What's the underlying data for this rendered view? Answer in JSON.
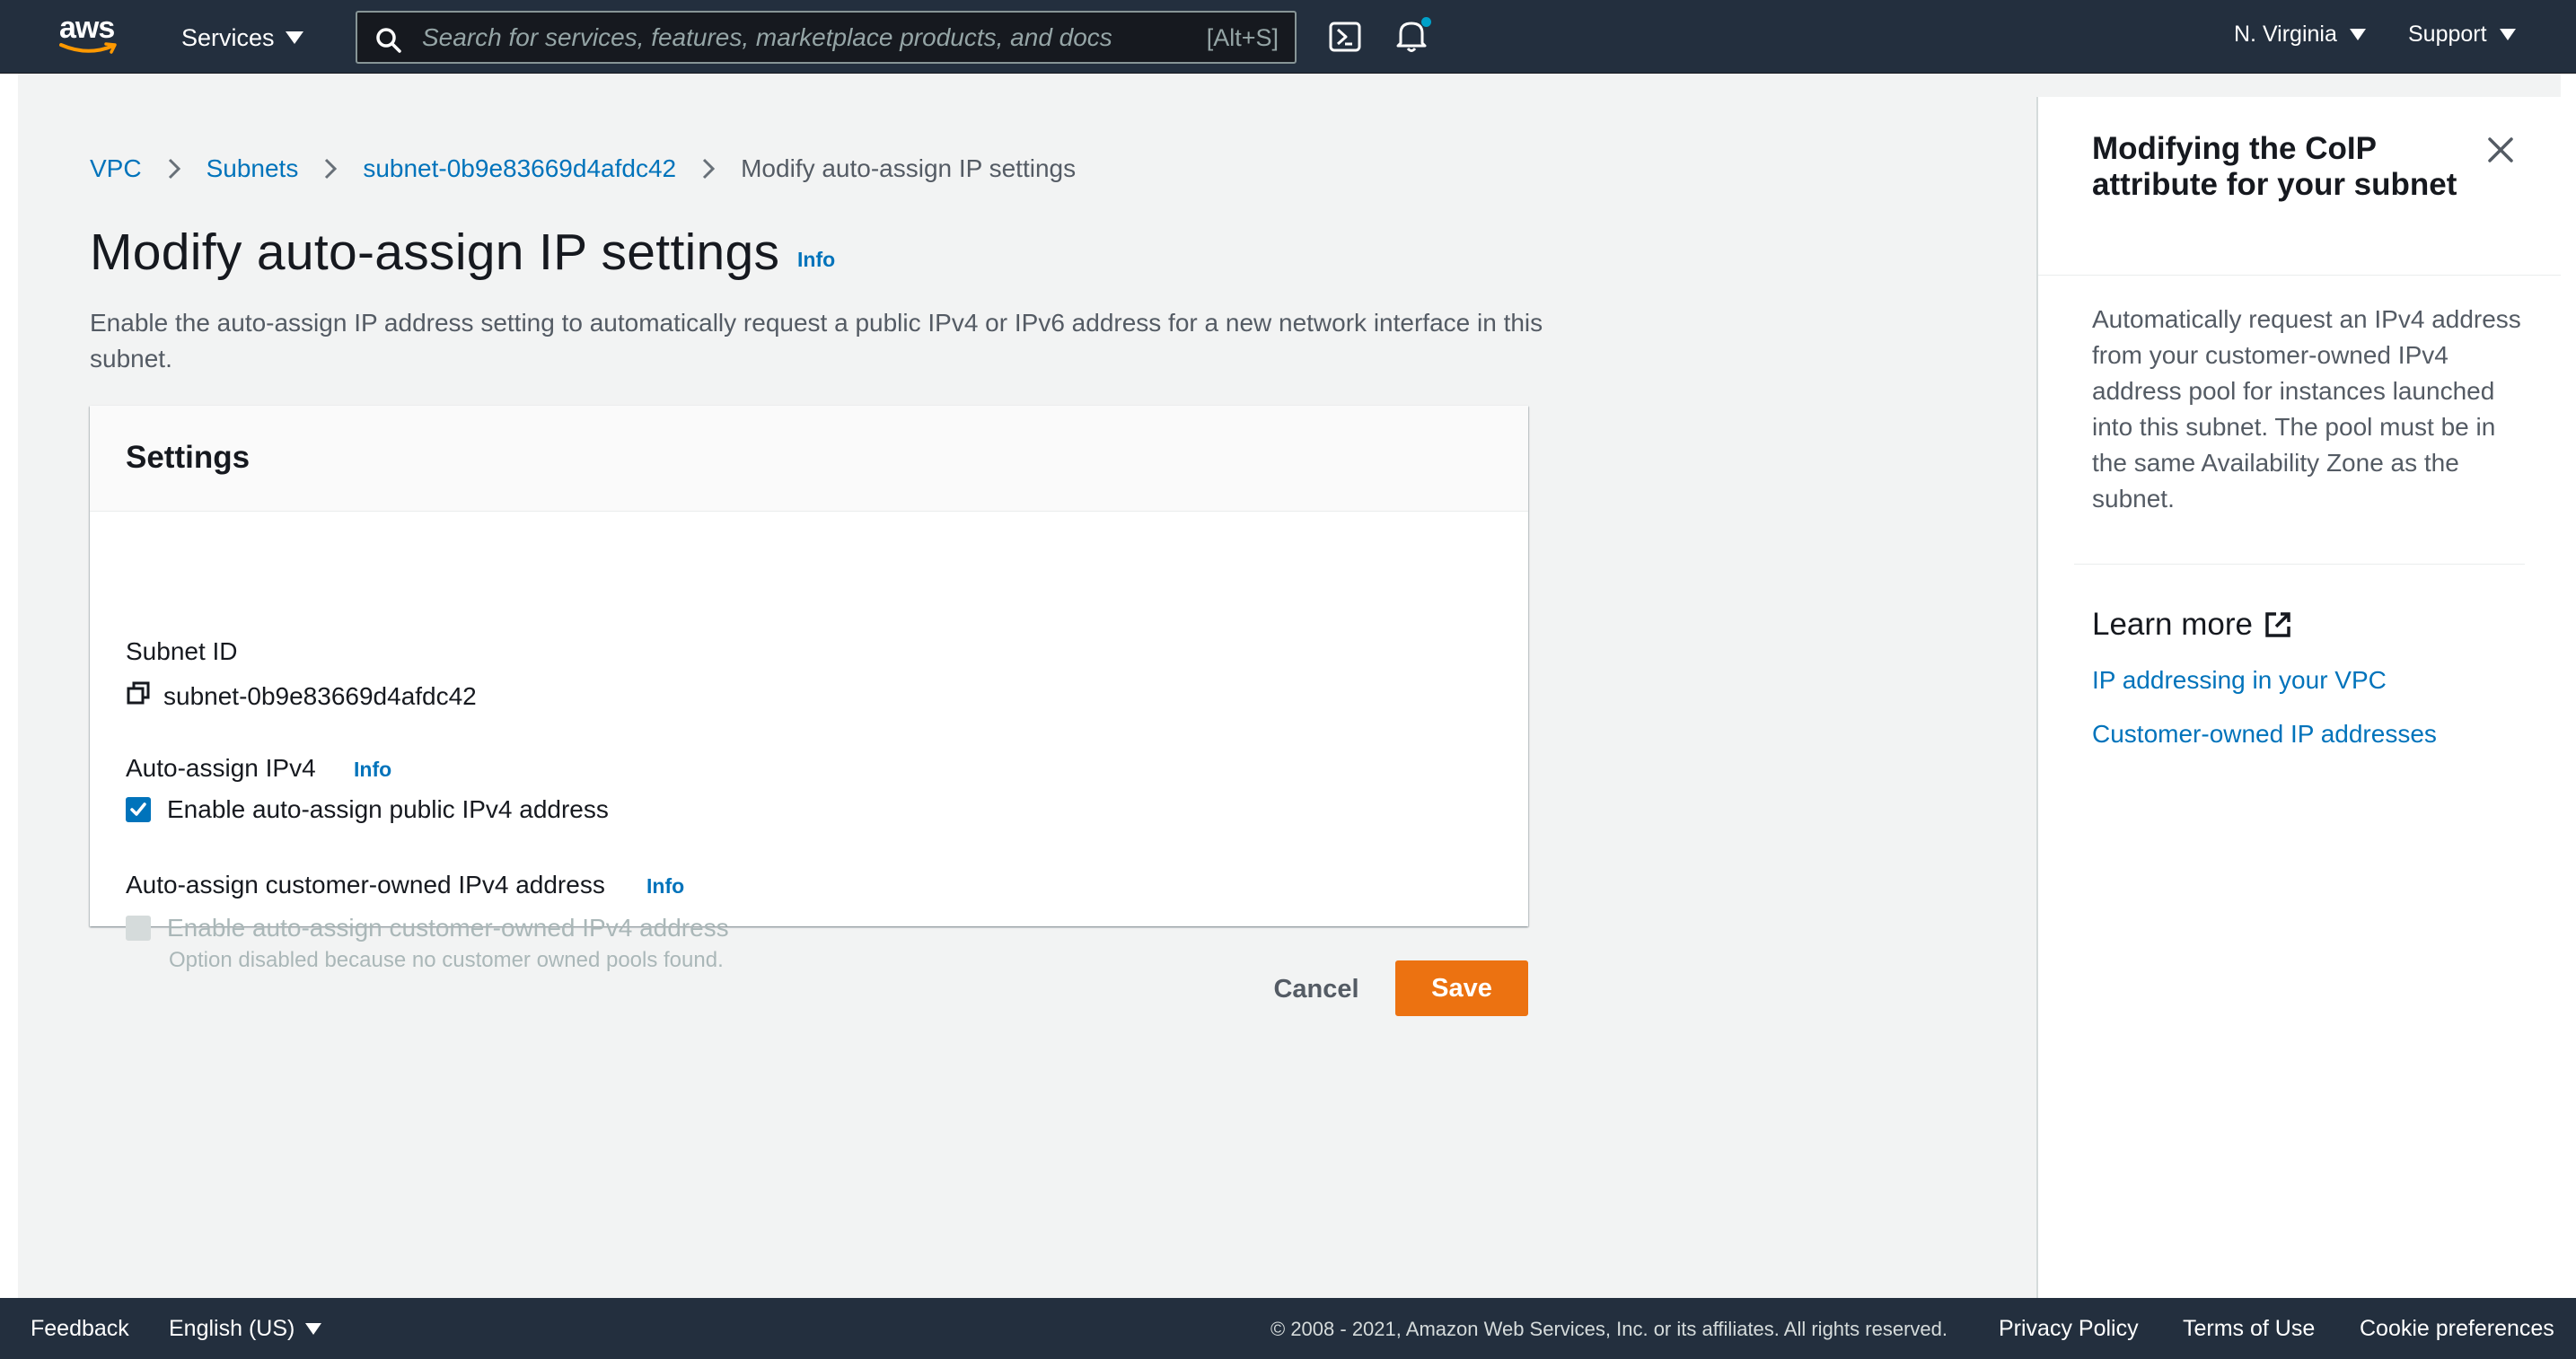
{
  "nav": {
    "logo_text": "aws",
    "services_label": "Services",
    "search_placeholder": "Search for services, features, marketplace products, and docs",
    "search_shortcut": "[Alt+S]",
    "region_label": "N. Virginia",
    "support_label": "Support"
  },
  "breadcrumb": {
    "items": [
      "VPC",
      "Subnets",
      "subnet-0b9e83669d4afdc42"
    ],
    "current": "Modify auto-assign IP settings"
  },
  "page": {
    "title": "Modify auto-assign IP settings",
    "info_label": "Info",
    "description": "Enable the auto-assign IP address setting to automatically request a public IPv4 or IPv6 address for a new network interface in this subnet."
  },
  "settings": {
    "header": "Settings",
    "subnet_id_label": "Subnet ID",
    "subnet_id_value": "subnet-0b9e83669d4afdc42",
    "ipv4_label": "Auto-assign IPv4",
    "ipv4_info": "Info",
    "ipv4_checkbox_label": "Enable auto-assign public IPv4 address",
    "ipv4_checked": true,
    "coip_label": "Auto-assign customer-owned IPv4 address",
    "coip_info": "Info",
    "coip_checkbox_label": "Enable auto-assign customer-owned IPv4 address",
    "coip_checked": false,
    "coip_hint": "Option disabled because no customer owned pools found."
  },
  "actions": {
    "cancel_label": "Cancel",
    "save_label": "Save"
  },
  "help_panel": {
    "title": "Modifying the CoIP attribute for your subnet",
    "body": "Automatically request an IPv4 address from your customer-owned IPv4 address pool for instances launched into this subnet. The pool must be in the same Availability Zone as the subnet.",
    "learn_more": "Learn more",
    "links": [
      "IP addressing in your VPC",
      "Customer-owned IP addresses"
    ]
  },
  "footer": {
    "feedback": "Feedback",
    "language": "English (US)",
    "copyright": "© 2008 - 2021, Amazon Web Services, Inc. or its affiliates. All rights reserved.",
    "privacy": "Privacy Policy",
    "terms": "Terms of Use",
    "cookies": "Cookie preferences"
  },
  "colors": {
    "nav_bg": "#232f3e",
    "link": "#0073bb",
    "primary_button": "#ec7211",
    "checkbox_on": "#0073bb"
  },
  "icons": [
    "aws-logo",
    "caret-down-icon",
    "search-icon",
    "cloudshell-icon",
    "bell-icon",
    "chevron-right-icon",
    "copy-icon",
    "check-icon",
    "close-icon",
    "external-link-icon"
  ]
}
